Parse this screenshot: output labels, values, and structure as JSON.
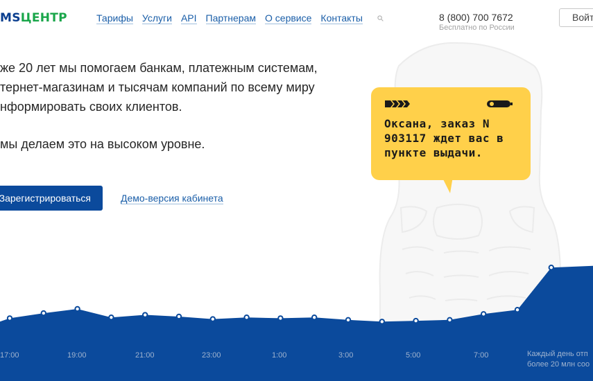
{
  "header": {
    "logo_ms": "MS",
    "logo_centr": "ЦЕНТР",
    "nav": [
      "Тарифы",
      "Услуги",
      "API",
      "Партнерам",
      "О сервисе",
      "Контакты"
    ],
    "phone": "8 (800) 700 7672",
    "phone_note": "Бесплатно по России",
    "login_label": "Войт"
  },
  "hero": {
    "line1": "же 20 лет мы помогаем банкам, платежным системам,",
    "line2": "тернет-магазинам и тысячам компаний по всему миру",
    "line3": "нформировать своих клиентов.",
    "line4": "мы делаем это на высоком уровне."
  },
  "cta": {
    "register_label": "Зарегистрироваться",
    "demo_label": "Демо-версия кабинета"
  },
  "sms_bubble": {
    "text": "Оксана, заказ N 903117 ждет вас в пункте выдачи."
  },
  "colors": {
    "brand_blue": "#0b4a9c",
    "brand_green": "#19a64a",
    "bubble_yellow": "#ffd04a",
    "link_blue": "#1a5ea8"
  },
  "chart_data": {
    "type": "area",
    "x": [
      "17:00",
      "19:00",
      "21:00",
      "23:00",
      "1:00",
      "3:00",
      "5:00",
      "7:00"
    ],
    "values": [
      30,
      36,
      41,
      31,
      34,
      32,
      29,
      31,
      30,
      31,
      28,
      26,
      27,
      28,
      35,
      40,
      90
    ],
    "note_line1": "Каждый день отп",
    "note_line2": "более 20 млн соо"
  }
}
